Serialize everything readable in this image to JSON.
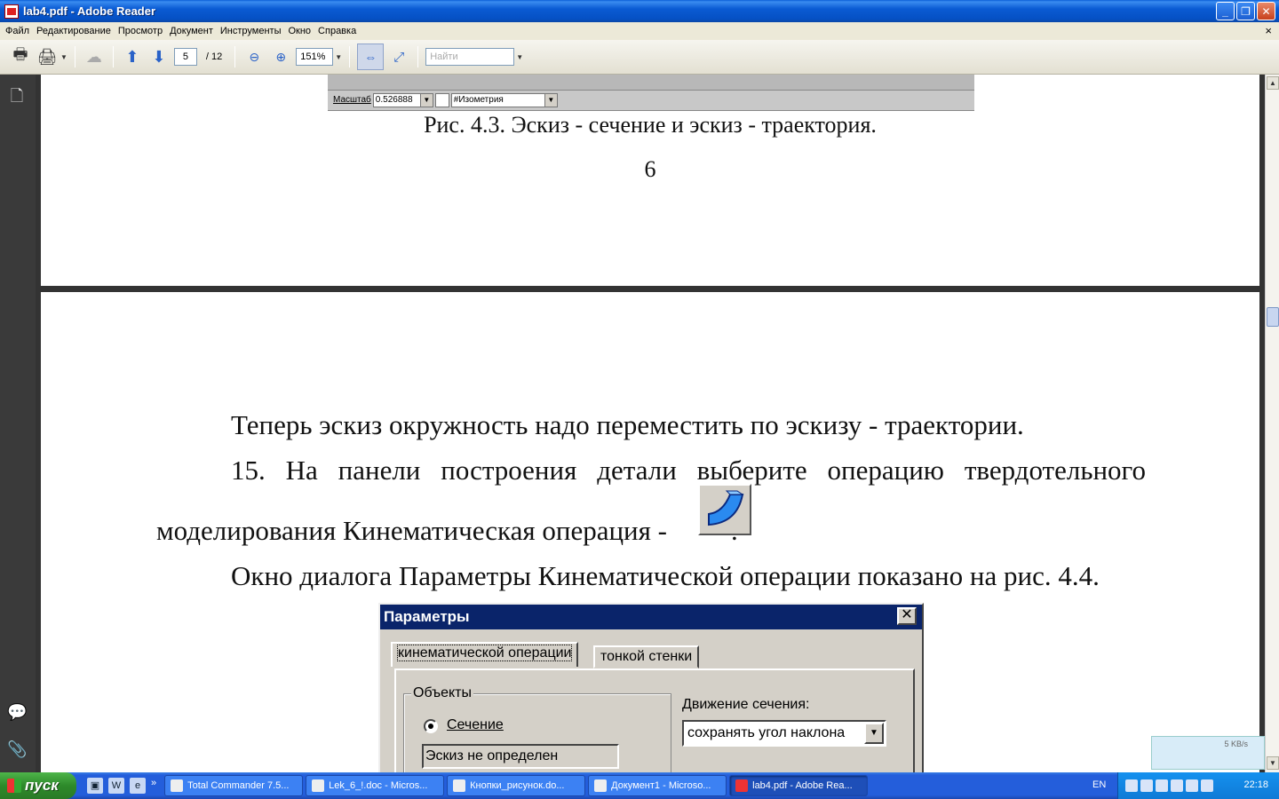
{
  "window": {
    "title": "lab4.pdf - Adobe Reader",
    "buttons": [
      "_",
      "❐",
      "✕"
    ]
  },
  "menu": {
    "items": [
      "Файл",
      "Редактирование",
      "Просмотр",
      "Документ",
      "Инструменты",
      "Окно",
      "Справка"
    ],
    "close": "×"
  },
  "toolbar": {
    "page_current": "5",
    "page_total": "/ 12",
    "zoom": "151%",
    "search_placeholder": "Найти"
  },
  "page_a": {
    "scale_label": "Масштаб",
    "scale_value": "0.526888",
    "view_value": "#Изометрия",
    "caption": "Рис. 4.3. Эскиз - сечение и эскиз - траектория.",
    "page_number": "6"
  },
  "page_b": {
    "para1": "Теперь эскиз окружность надо переместить по эскизу - траектории.",
    "para2_words": [
      "15.",
      "На",
      "панели",
      "построения",
      "детали",
      "выберите",
      "операцию",
      "твердотельного"
    ],
    "para3": "моделирования Кинематическая операция -",
    "para3_end": ".",
    "para4": "Окно диалога Параметры Кинематической операции показано на рис. 4.4."
  },
  "dialog": {
    "title": "Параметры",
    "tab_active": "кинематической операции",
    "tab_other": "тонкой стенки",
    "group_objects": "Объекты",
    "radio_section": "Сечение",
    "status": "Эскиз не определен",
    "motion_label": "Движение сечения:",
    "motion_value": "сохранять  угол наклона"
  },
  "taskbar": {
    "start": "пуск",
    "tasks": [
      {
        "label": "Total Commander 7.5..."
      },
      {
        "label": "Lek_6_!.doc - Micros..."
      },
      {
        "label": "Кнопки_рисунок.do..."
      },
      {
        "label": "Документ1 - Microso..."
      },
      {
        "label": "lab4.pdf - Adobe Rea..."
      }
    ],
    "lang": "EN",
    "clock": "22:18",
    "net_speed": "5 KB/s"
  }
}
